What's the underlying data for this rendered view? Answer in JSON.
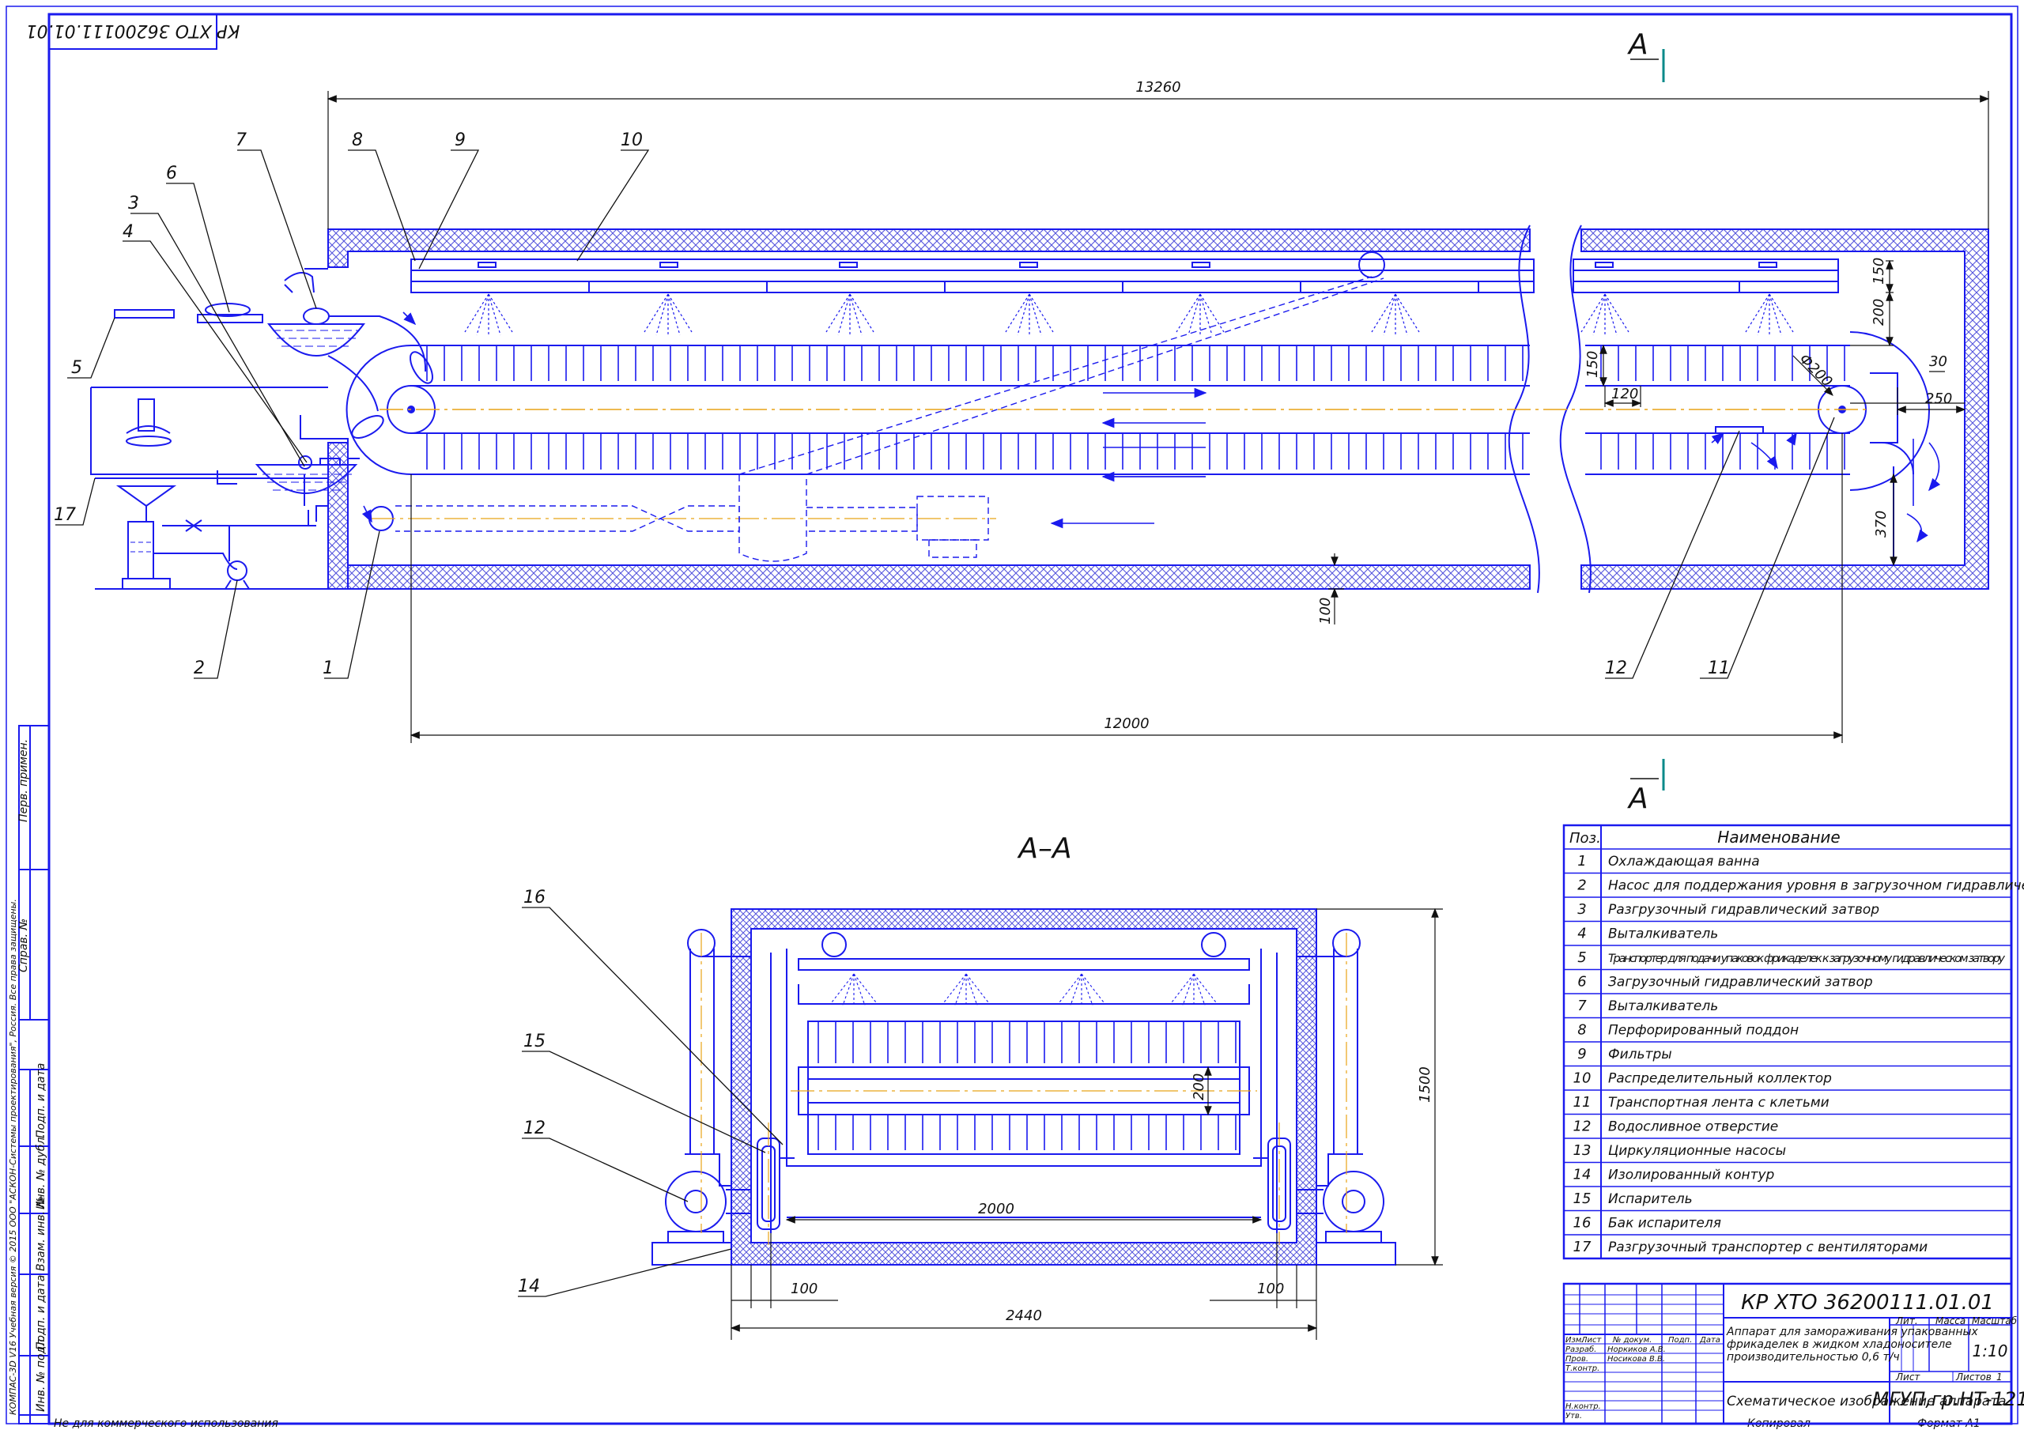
{
  "colors": {
    "line": "#1a1aee",
    "frame": "#1a1aee",
    "text": "#111111",
    "axis": "#e8a317",
    "hatch": "#5555dd",
    "cut_mark": "#0a8a8a"
  },
  "stamp_rotated": "КР ХТО 36200111.01.01",
  "section_mark": "А",
  "section_title": "А–А",
  "dimensions": {
    "overall_length": "13260",
    "conveyor_length": "12000",
    "d150_top": "150",
    "d200": "200",
    "d150_left": "150",
    "d120": "120",
    "d30": "30",
    "d250": "250",
    "d370": "370",
    "d100_bottom": "100",
    "phi200": "Ф200",
    "sec_1500": "1500",
    "sec_200": "200",
    "sec_2000": "2000",
    "sec_2440": "2440",
    "sec_100_left": "100",
    "sec_100_right": "100"
  },
  "callouts_main": [
    "1",
    "2",
    "3",
    "4",
    "5",
    "6",
    "7",
    "8",
    "9",
    "10",
    "11",
    "12",
    "17"
  ],
  "callouts_section": [
    "12",
    "14",
    "15",
    "16"
  ],
  "parts_table": {
    "header_pos": "Поз.",
    "header_name": "Наименование",
    "rows": [
      {
        "pos": "1",
        "name": "Охлаждающая ванна"
      },
      {
        "pos": "2",
        "name": "Насос для поддержания уровня в загрузочном гидравлическом затворе"
      },
      {
        "pos": "3",
        "name": "Разгрузочный гидравлический затвор"
      },
      {
        "pos": "4",
        "name": "Выталкиватель"
      },
      {
        "pos": "5",
        "name": "Транспортер для подачи упаковок фрикаделек к загрузочному гидравлическом затвору"
      },
      {
        "pos": "6",
        "name": "Загрузочный гидравлический затвор"
      },
      {
        "pos": "7",
        "name": "Выталкиватель"
      },
      {
        "pos": "8",
        "name": "Перфорированный поддон"
      },
      {
        "pos": "9",
        "name": "Фильтры"
      },
      {
        "pos": "10",
        "name": "Распределительный коллектор"
      },
      {
        "pos": "11",
        "name": "Транспортная лента с клетьми"
      },
      {
        "pos": "12",
        "name": "Водосливное отверстие"
      },
      {
        "pos": "13",
        "name": "Циркуляционные насосы"
      },
      {
        "pos": "14",
        "name": "Изолированный контур"
      },
      {
        "pos": "15",
        "name": "Испаритель"
      },
      {
        "pos": "16",
        "name": "Бак испарителя"
      },
      {
        "pos": "17",
        "name": "Разгрузочный транспортер с вентиляторами"
      }
    ]
  },
  "title_block": {
    "code": "КР ХТО 36200111.01.01",
    "title_lines": [
      "Аппарат для замораживания упакованных",
      "фрикаделек в жидком хладоносителе",
      "производительностью 0,6 т/ч"
    ],
    "sheet_title": "Схематическое изображение аппарата",
    "organization": "МГУП,гр.НТ-121",
    "col_izm": "Изм.",
    "col_list": "Лист",
    "col_doc": "№ докум.",
    "col_sign": "Подп.",
    "col_date": "Дата",
    "role_razrab": "Разраб.",
    "role_prov": "Пров.",
    "role_tkontr": "Т.контр.",
    "role_nkontr": "Н.контр.",
    "role_utv": "Утв.",
    "name_razrab": "Норкиков А.В.",
    "name_prov": "Носикова В.В.",
    "lit": "Лит.",
    "massa": "Масса",
    "masshtab": "Масштаб",
    "scale": "1:10",
    "list_label": "Лист",
    "listov_label": "Листов",
    "listov_value": "1",
    "kopiroval": "Копировал",
    "format": "Формат    А1"
  },
  "side_strip": {
    "perv_primen": "Перв. примен.",
    "sprav_no": "Справ. №",
    "podp_data_1": "Подп. и дата",
    "inv_dubl": "Инв. № дубл.",
    "vzam_inv": "Взам. инв. №",
    "podp_data_2": "Подп. и дата",
    "inv_podl": "Инв. № подл.",
    "copyright": "КОМПАС-3D V16 Учебная версия © 2015 ООО \"АСКОН-Системы проектирования\", Россия. Все права защищены."
  },
  "footer_note": "Не для коммерческого использования"
}
